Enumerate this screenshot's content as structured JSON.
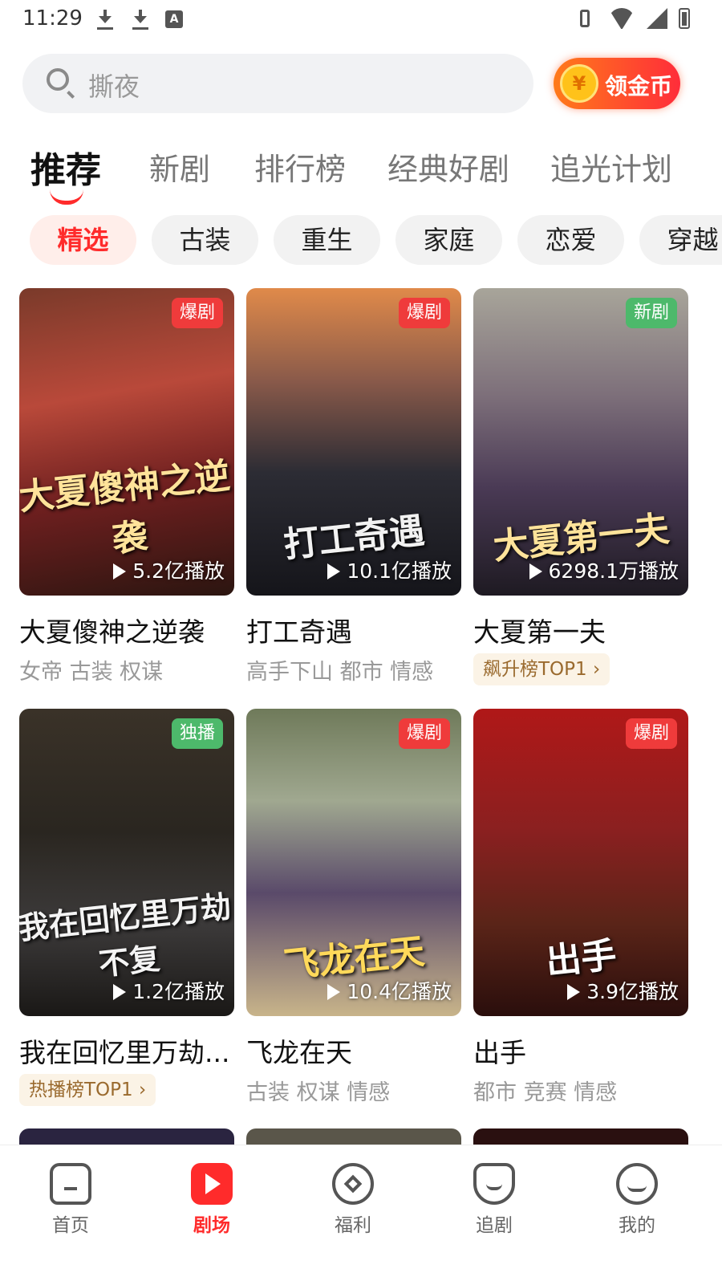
{
  "status_bar": {
    "time": "11:29",
    "left_icons": [
      "download-icon",
      "download-icon",
      "font-a-icon"
    ],
    "right_icons": [
      "vibrate-icon",
      "wifi-icon",
      "signal-icon",
      "battery-icon"
    ]
  },
  "search": {
    "placeholder": "撕夜",
    "coin_button_label": "领金币",
    "coin_symbol": "¥"
  },
  "tabs": [
    "推荐",
    "新剧",
    "排行榜",
    "经典好剧",
    "追光计划"
  ],
  "active_tab": "推荐",
  "chips": [
    "精选",
    "古装",
    "重生",
    "家庭",
    "恋爱",
    "穿越"
  ],
  "active_chip": "精选",
  "dramas": [
    {
      "title": "大夏傻神之逆袭",
      "poster_title": "大夏傻神之逆袭",
      "badge": "爆剧",
      "badge_color": "#ef3b3b",
      "plays": "5.2亿播放",
      "tags": "女帝 古装 权谋",
      "rank": ""
    },
    {
      "title": "打工奇遇",
      "poster_title": "打工奇遇",
      "badge": "爆剧",
      "badge_color": "#ef3b3b",
      "plays": "10.1亿播放",
      "tags": "高手下山 都市 情感",
      "rank": ""
    },
    {
      "title": "大夏第一夫",
      "poster_title": "大夏第一夫",
      "badge": "新剧",
      "badge_color": "#4db96b",
      "plays": "6298.1万播放",
      "tags": "",
      "rank": "飙升榜TOP1 ›"
    },
    {
      "title": "我在回忆里万劫...",
      "poster_title": "我在回忆里万劫不复",
      "badge": "独播",
      "badge_color": "#4db96b",
      "plays": "1.2亿播放",
      "tags": "",
      "rank": "热播榜TOP1 ›"
    },
    {
      "title": "飞龙在天",
      "poster_title": "飞龙在天",
      "badge": "爆剧",
      "badge_color": "#ef3b3b",
      "plays": "10.4亿播放",
      "tags": "古装 权谋 情感",
      "rank": ""
    },
    {
      "title": "出手",
      "poster_title": "出手",
      "badge": "爆剧",
      "badge_color": "#ef3b3b",
      "plays": "3.9亿播放",
      "tags": "都市 竞赛 情感",
      "rank": ""
    }
  ],
  "bottom_nav": [
    {
      "label": "首页",
      "icon": "home-icon"
    },
    {
      "label": "剧场",
      "icon": "theater-icon"
    },
    {
      "label": "福利",
      "icon": "welfare-icon"
    },
    {
      "label": "追剧",
      "icon": "follow-icon"
    },
    {
      "label": "我的",
      "icon": "profile-icon"
    }
  ],
  "active_nav": "剧场",
  "colors": {
    "accent": "#ff2b2b",
    "coin_gradient_start": "#ff7a1a",
    "coin_gradient_end": "#ff2d3a",
    "rank_text": "#9a6a2e"
  }
}
